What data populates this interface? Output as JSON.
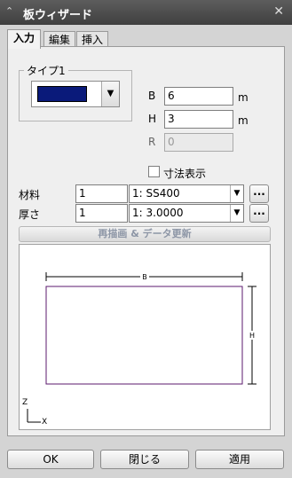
{
  "window": {
    "title": "板ウィザード"
  },
  "tabs": [
    {
      "label": "入力"
    },
    {
      "label": "編集"
    },
    {
      "label": "挿入"
    }
  ],
  "type_group": {
    "label": "タイプ1",
    "color": "#0a1a7a"
  },
  "params": {
    "b": {
      "label": "B",
      "value": "6",
      "unit": "m"
    },
    "h": {
      "label": "H",
      "value": "3",
      "unit": "m"
    },
    "r": {
      "label": "R",
      "value": "0"
    }
  },
  "dimension_display": {
    "label": "寸法表示",
    "checked": false
  },
  "material": {
    "label": "材料",
    "number": "1",
    "selected": "1: SS400",
    "more": "..."
  },
  "thickness": {
    "label": "厚さ",
    "number": "1",
    "selected": "1: 3.0000",
    "more": "..."
  },
  "redraw_button": {
    "label": "再描画 & データ更新"
  },
  "preview": {
    "b_label": "B",
    "h_label": "H",
    "axis_z": "Z",
    "axis_x": "X",
    "outline_color": "#5b1a6e"
  },
  "buttons": {
    "ok": "OK",
    "close": "閉じる",
    "apply": "適用"
  }
}
